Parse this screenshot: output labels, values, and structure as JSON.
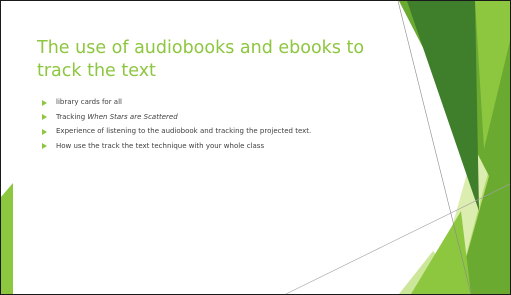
{
  "slide": {
    "title": "The use of audiobooks and ebooks to track the text",
    "bullets": [
      {
        "text": "library cards for all"
      },
      {
        "prefix": "Tracking ",
        "emphasis": "When Stars are Scattered"
      },
      {
        "text": "Experience of listening to the audiobook and tracking the projected text."
      },
      {
        "text": "How use the track the text technique with your whole class"
      }
    ]
  },
  "theme": {
    "accent": "#8dc63f",
    "dark_green": "#3d7a2c",
    "mid_green": "#5e9c2f",
    "light_green": "#c5e07a",
    "text": "#404040"
  },
  "icons": {
    "bullet": "triangle-right-icon"
  }
}
